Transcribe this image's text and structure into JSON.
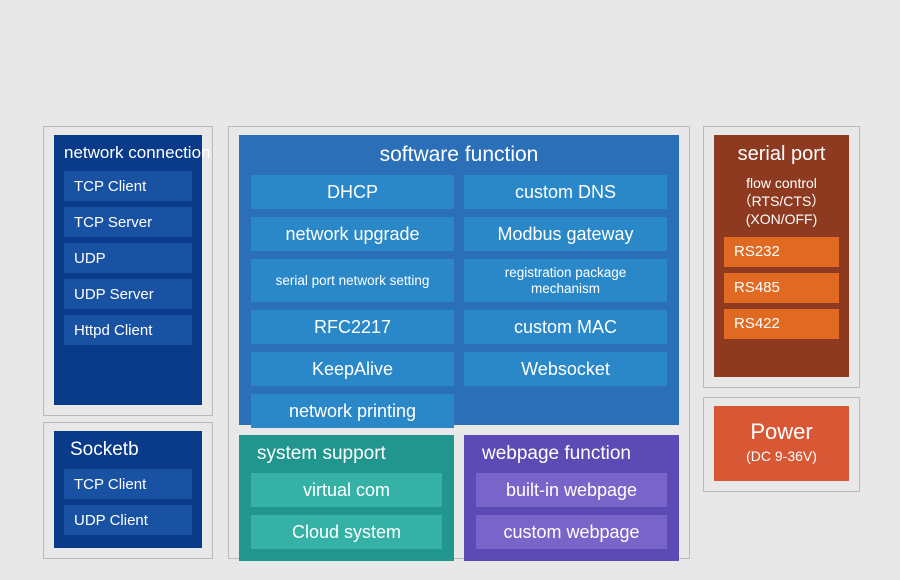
{
  "network_connection": {
    "title": "network connection",
    "items": [
      "TCP Client",
      "TCP Server",
      "UDP",
      "UDP Server",
      "Httpd Client"
    ]
  },
  "socketb": {
    "title": "Socketb",
    "items": [
      "TCP Client",
      "UDP Client"
    ]
  },
  "software_function": {
    "title": "software function",
    "left": [
      "DHCP",
      "network upgrade",
      "serial port network setting",
      "RFC2217",
      "KeepAlive",
      "network printing"
    ],
    "right": [
      "custom DNS",
      "Modbus gateway",
      "registration package mechanism",
      "custom MAC",
      "Websocket"
    ]
  },
  "system_support": {
    "title": "system support",
    "items": [
      "virtual com",
      "Cloud system"
    ]
  },
  "webpage_function": {
    "title": "webpage function",
    "items": [
      "built-in webpage",
      "custom webpage"
    ]
  },
  "serial_port": {
    "title": "serial port",
    "subtitle": "flow control（RTS/CTS）(XON/OFF)",
    "items": [
      "RS232",
      "RS485",
      "RS422"
    ]
  },
  "power": {
    "title": "Power",
    "subtitle": "(DC 9-36V)"
  }
}
